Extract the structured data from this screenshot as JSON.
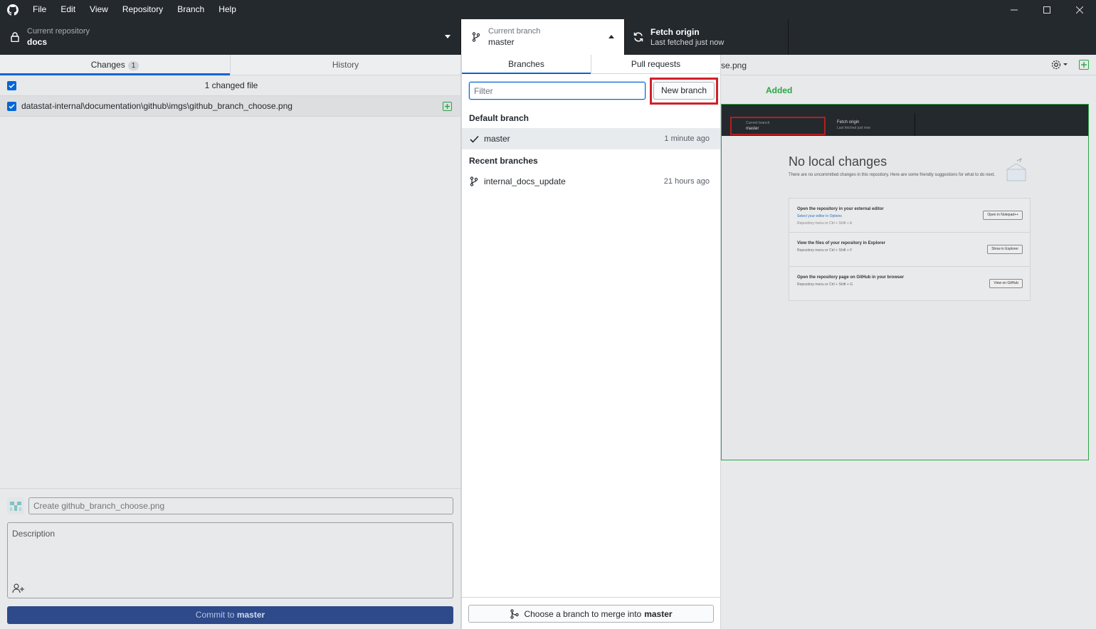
{
  "menu": [
    "File",
    "Edit",
    "View",
    "Repository",
    "Branch",
    "Help"
  ],
  "toolbar": {
    "repo_label": "Current repository",
    "repo_value": "docs",
    "branch_label": "Current branch",
    "branch_value": "master",
    "fetch_label": "Fetch origin",
    "fetch_sub": "Last fetched just now"
  },
  "left": {
    "tab_changes": "Changes",
    "changes_count": "1",
    "tab_history": "History",
    "changed_count_text": "1 changed file",
    "file_path": "datastat-internal\\documentation\\github\\imgs\\github_branch_choose.png",
    "summary_placeholder": "Create github_branch_choose.png",
    "description_placeholder": "Description",
    "commit_prefix": "Commit to",
    "commit_branch": "master"
  },
  "right": {
    "filename_fragment": "se.png",
    "added_label": "Added",
    "preview": {
      "branch_label": "Current branch",
      "branch_value": "master",
      "fetch_label": "Fetch origin",
      "fetch_sub": "Last fetched just now",
      "title": "No local changes",
      "subtitle": "There are no uncommitted changes in this repository. Here are some friendly suggestions for what to do next.",
      "rows": [
        {
          "title": "Open the repository in your external editor",
          "sub": "Select your editor in Options",
          "sub2": "Repository menu or  Ctrl + Shift + A",
          "button": "Open in Notepad++"
        },
        {
          "title": "View the files of your repository in Explorer",
          "sub": "Repository menu or  Ctrl + Shift + F",
          "sub2": "",
          "button": "Show in Explorer"
        },
        {
          "title": "Open the repository page on GitHub in your browser",
          "sub": "Repository menu or  Ctrl + Shift + G",
          "sub2": "",
          "button": "View on GitHub"
        }
      ]
    }
  },
  "dropdown": {
    "tab_branches": "Branches",
    "tab_pull_requests": "Pull requests",
    "filter_placeholder": "Filter",
    "new_branch": "New branch",
    "default_header": "Default branch",
    "default_branch": {
      "name": "master",
      "time": "1 minute ago"
    },
    "recent_header": "Recent branches",
    "recent_branches": [
      {
        "name": "internal_docs_update",
        "time": "21 hours ago"
      }
    ],
    "merge_prefix": "Choose a branch to merge into",
    "merge_branch": "master"
  },
  "colors": {
    "titlebar": "#24292e",
    "accent": "#0366d6",
    "added": "#28a745",
    "highlight": "#d0202a",
    "commit_button": "#2f4a8a"
  }
}
